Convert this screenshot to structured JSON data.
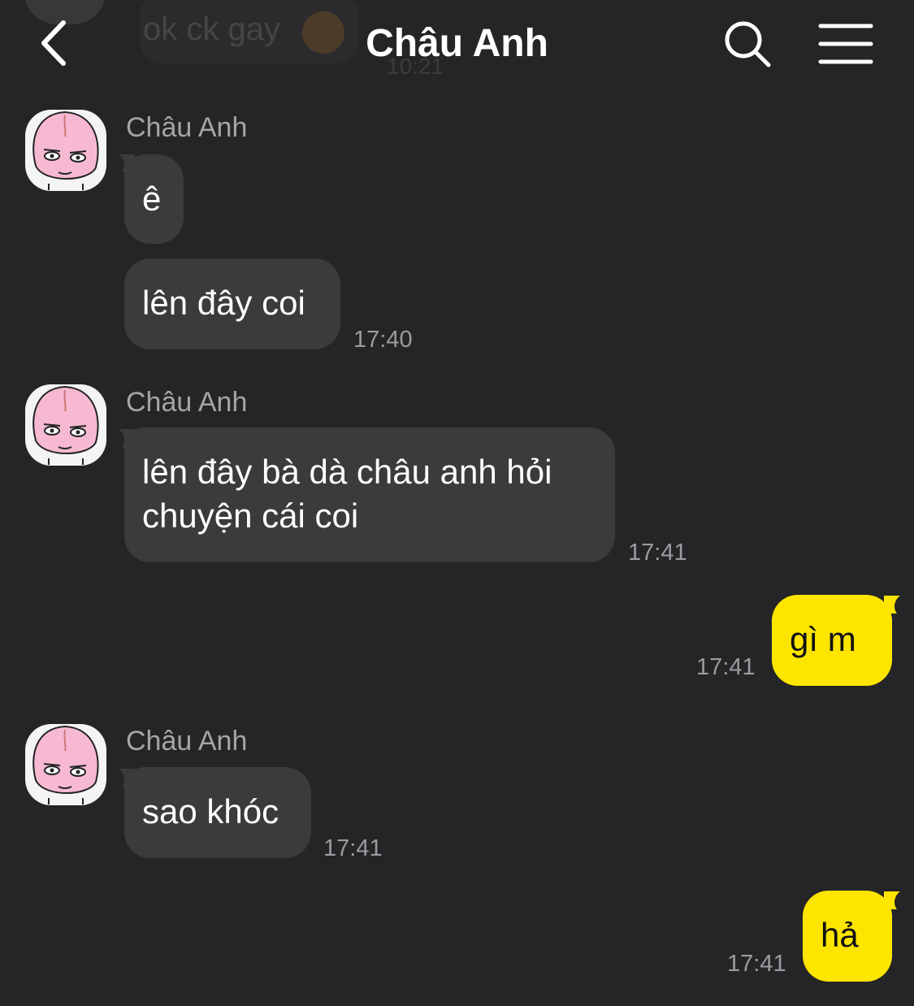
{
  "header": {
    "title": "Châu Anh"
  },
  "previous_message": {
    "text": "ok ck gay",
    "time": "10:21"
  },
  "messages": [
    {
      "sender": "Châu Anh",
      "texts": [
        "ê",
        "lên đây coi"
      ],
      "time": "17:40"
    },
    {
      "sender": "Châu Anh",
      "texts": [
        "lên đây bà dà châu anh hỏi",
        "chuyện cái coi"
      ],
      "time": "17:41"
    },
    {
      "sender": "me",
      "texts": [
        "gì m"
      ],
      "time": "17:41"
    },
    {
      "sender": "Châu Anh",
      "texts": [
        "sao khóc"
      ],
      "time": "17:41"
    },
    {
      "sender": "me",
      "texts": [
        "hả"
      ],
      "time": "17:41"
    }
  ],
  "colors": {
    "background": "#252527",
    "incoming_bubble": "#3b3b3e",
    "outgoing_bubble": "#fde500",
    "timestamp": "#9c9ca0"
  },
  "icons": [
    "back-arrow-icon",
    "search-icon",
    "menu-icon",
    "avatar-sticker"
  ]
}
